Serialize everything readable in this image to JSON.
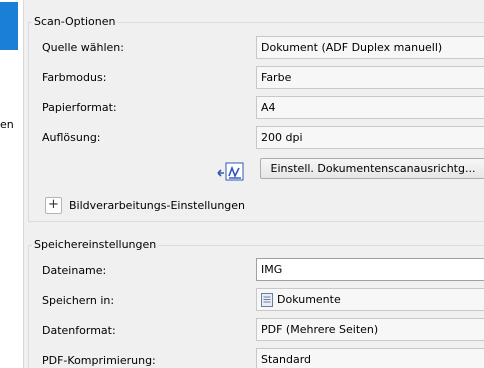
{
  "sidebar": {
    "partial_label": "en"
  },
  "scan_options": {
    "title": "Scan-Optionen",
    "source": {
      "label": "Quelle wählen:",
      "value": "Dokument (ADF Duplex manuell)"
    },
    "color_mode": {
      "label": "Farbmodus:",
      "value": "Farbe"
    },
    "paper_format": {
      "label": "Papierformat:",
      "value": "A4"
    },
    "resolution": {
      "label": "Auflösung:",
      "value": "200 dpi"
    },
    "align_button": "Einstell. Dokumentenscanausrichtg...",
    "image_settings_toggle": "+",
    "image_settings_label": "Bildverarbeitungs-Einstellungen"
  },
  "save_settings": {
    "title": "Speichereinstellungen",
    "filename": {
      "label": "Dateiname:",
      "value": "IMG"
    },
    "save_in": {
      "label": "Speichern in:",
      "value": "Dokumente",
      "icon": "documents-folder-icon"
    },
    "file_format": {
      "label": "Datenformat:",
      "value": "PDF (Mehrere Seiten)"
    },
    "pdf_compression": {
      "label": "PDF-Komprimierung:",
      "value": "Standard"
    }
  },
  "colors": {
    "accent": "#1a7fd6",
    "panel_bg": "#f0f0f0"
  }
}
